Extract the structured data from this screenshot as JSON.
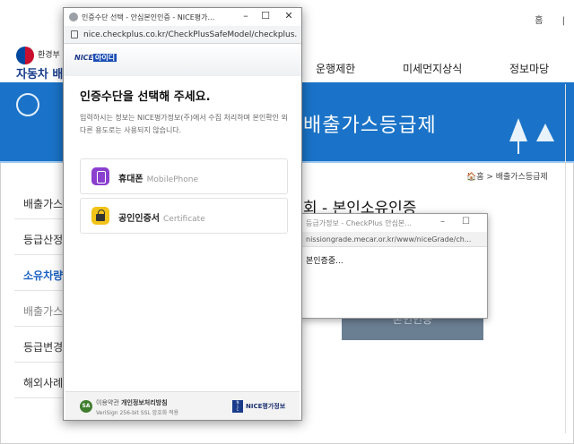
{
  "site": {
    "top_links": [
      "홈",
      "|"
    ],
    "logo_line1": "환경부",
    "logo_line2": "자동차 배출",
    "gnb": [
      "운행제한",
      "미세먼지상식",
      "정보마당"
    ],
    "banner_title": "배출가스등급제",
    "breadcrumb": "🏠홈 > 배출가스등급제",
    "lnb": [
      "배출가스",
      "등급산정",
      "소유차량",
      "배출가스",
      "등급변경",
      "해외사례"
    ],
    "page_heading": "회 - 본인소유인증",
    "gray_button": "본인인증"
  },
  "popup2": {
    "title": "등급가정보 - CheckPlus 안심본...",
    "url": "nissiongrade.mecar.or.kr/www/niceGrade/ch...",
    "body": "본인증중..."
  },
  "popup": {
    "title": "인증수단 선택 - 안심본인인증 - NICE평가...",
    "url": "nice.checkplus.co.kr/CheckPlusSafeModel/checkplus.c...",
    "brand_prefix": "NICE",
    "brand_name": "아이디",
    "heading": "인증수단을 선택해 주세요.",
    "description": "입력하시는 정보는 NICE평가정보(주)에서 수집 처리하며 본인확인 외 다른 용도로는 사용되지 않습니다.",
    "options": [
      {
        "label": "휴대폰",
        "sub": "MobilePhone",
        "icon": "mobile-phone-icon"
      },
      {
        "label": "공인인증서",
        "sub": "Certificate",
        "icon": "lock-icon"
      }
    ],
    "footer": {
      "terms": "이용약관",
      "privacy": "개인정보처리방침",
      "ssl": "VeriSign 256-bit SSL 암호화 적용",
      "seal": "SA",
      "company": "NICE평가정보"
    }
  }
}
